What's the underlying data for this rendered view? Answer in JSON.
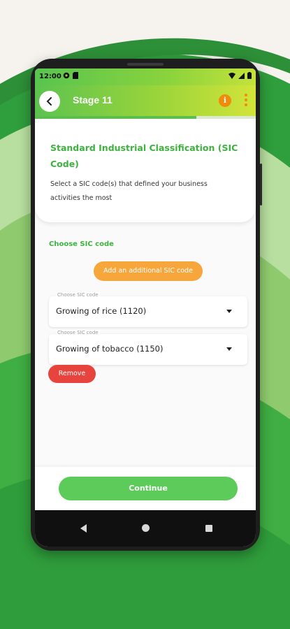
{
  "status_bar": {
    "time": "12:00"
  },
  "app_bar": {
    "title": "Stage 11",
    "info_glyph": "i"
  },
  "progress": {
    "fraction": 0.73
  },
  "header": {
    "title": "Standard Industrial Classification (SIC Code)",
    "description": "Select a SIC code(s) that defined your business activities the most"
  },
  "section": {
    "choose_label": "Choose SIC code",
    "add_button": "Add an additional SIC code"
  },
  "selects": [
    {
      "label": "Choose SIC code",
      "value": "Growing of rice (1120)"
    },
    {
      "label": "Choose SIC code",
      "value": "Growing of tobacco (1150)"
    }
  ],
  "remove_button": "Remove",
  "continue_button": "Continue",
  "colors": {
    "accent_green": "#3db33e",
    "orange": "#f6a63a",
    "danger": "#e6443c",
    "button_green": "#5ccb5a"
  }
}
